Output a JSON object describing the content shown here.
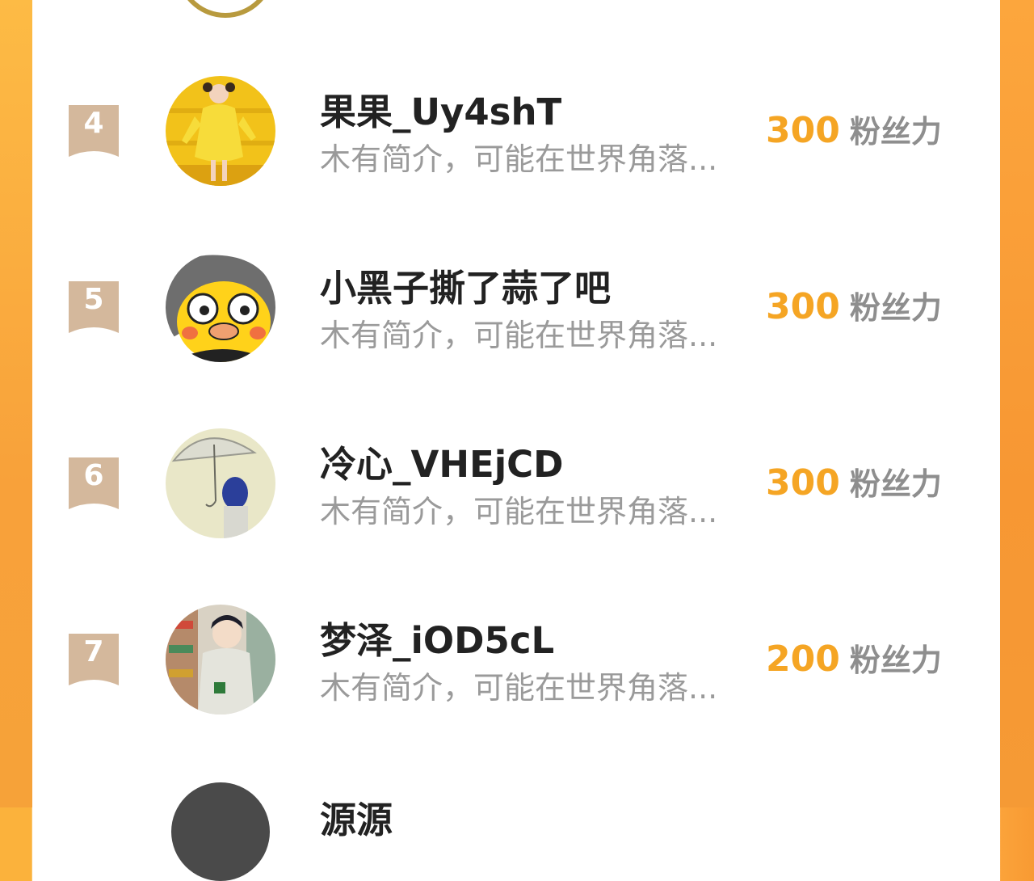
{
  "leaderboard": {
    "unit_label": "粉丝力",
    "rows": [
      {
        "rank": "4",
        "name": "果果_Uy4shT",
        "bio": "木有简介，可能在世界角落...",
        "score": "300",
        "avatar": "girl-yellow-dress-avatar"
      },
      {
        "rank": "5",
        "name": "小黑子撕了蒜了吧",
        "bio": "木有简介，可能在世界角落...",
        "score": "300",
        "avatar": "cartoon-duck-avatar"
      },
      {
        "rank": "6",
        "name": "冷心_VHEjCD",
        "bio": "木有简介，可能在世界角落...",
        "score": "300",
        "avatar": "umbrella-girl-avatar"
      },
      {
        "rank": "7",
        "name": "梦泽_iOD5cL",
        "bio": "木有简介，可能在世界角落...",
        "score": "200",
        "avatar": "anime-boy-avatar"
      }
    ],
    "partial_next_name": "源源"
  },
  "colors": {
    "score": "#f5a524",
    "badge": "#d4b89c",
    "border_orange": "#f89a33"
  }
}
